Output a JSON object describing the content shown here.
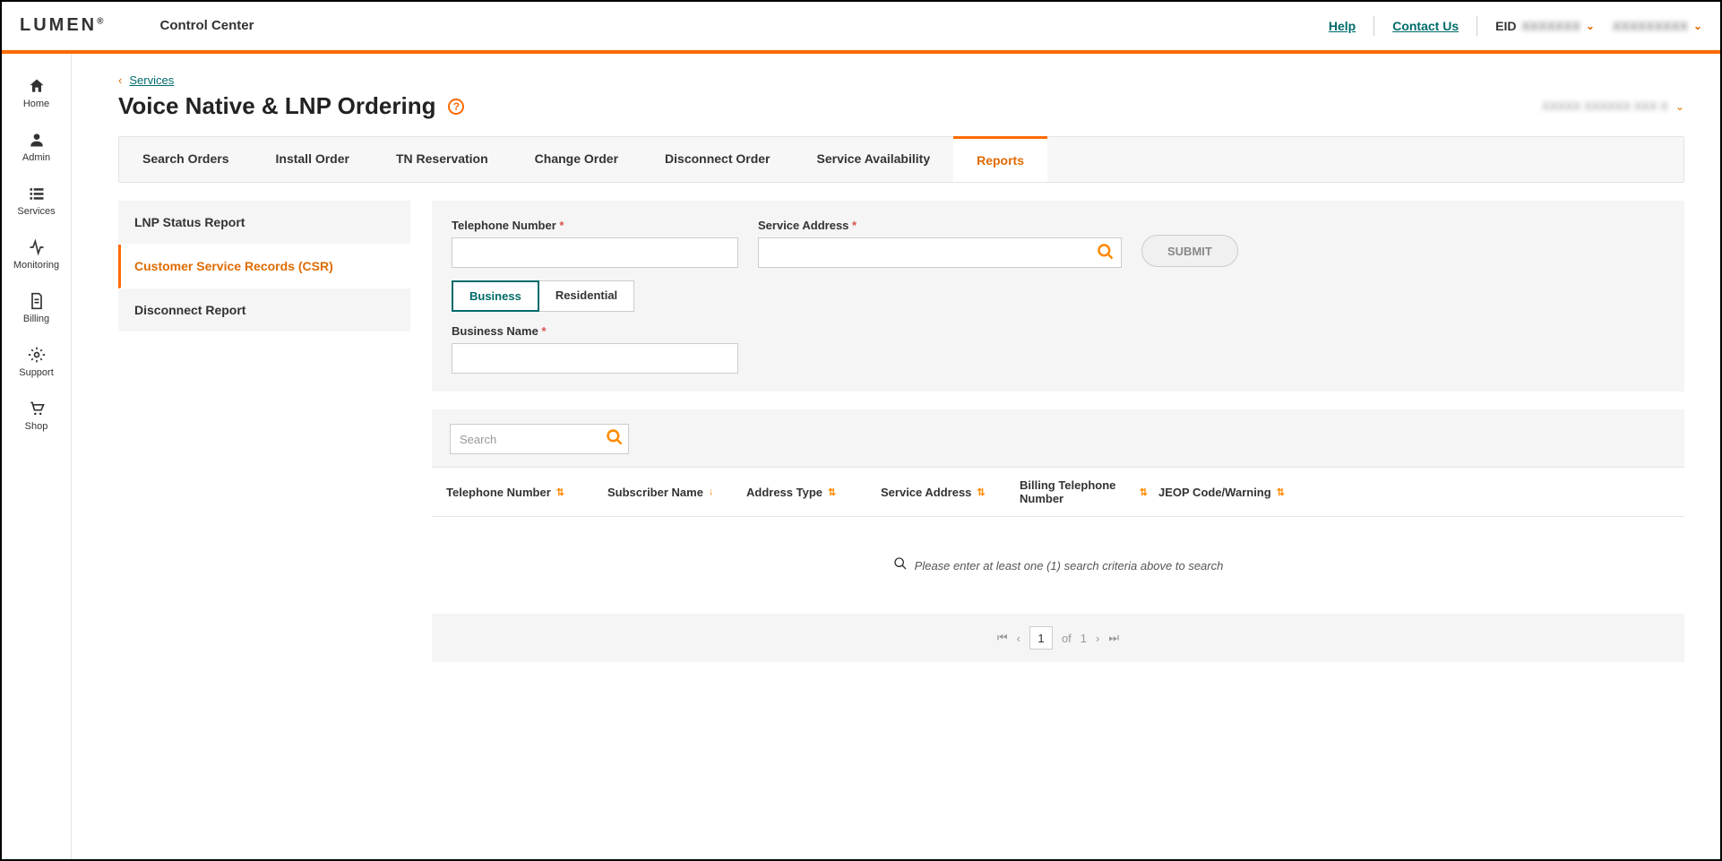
{
  "header": {
    "logo": "LUMEN",
    "app_title": "Control Center",
    "help": "Help",
    "contact": "Contact Us",
    "eid_label": "EID",
    "eid_value": "XXXXXXX",
    "account_label": "XXXXXXXXX"
  },
  "sidebar": {
    "items": [
      {
        "label": "Home"
      },
      {
        "label": "Admin"
      },
      {
        "label": "Services"
      },
      {
        "label": "Monitoring"
      },
      {
        "label": "Billing"
      },
      {
        "label": "Support"
      },
      {
        "label": "Shop"
      }
    ]
  },
  "breadcrumb": {
    "link": "Services"
  },
  "page": {
    "title": "Voice Native & LNP Ordering",
    "account_selector": "XXXXX XXXXXX XXX X"
  },
  "tabs": {
    "items": [
      {
        "label": "Search Orders"
      },
      {
        "label": "Install Order"
      },
      {
        "label": "TN Reservation"
      },
      {
        "label": "Change Order"
      },
      {
        "label": "Disconnect Order"
      },
      {
        "label": "Service Availability"
      },
      {
        "label": "Reports",
        "active": true
      }
    ]
  },
  "subnav": {
    "items": [
      {
        "label": "LNP Status Report"
      },
      {
        "label": "Customer Service Records (CSR)",
        "active": true
      },
      {
        "label": "Disconnect Report"
      }
    ]
  },
  "form": {
    "tn_label": "Telephone Number",
    "addr_label": "Service Address",
    "submit": "SUBMIT",
    "toggle": {
      "business": "Business",
      "residential": "Residential"
    },
    "bn_label": "Business Name"
  },
  "table": {
    "search_placeholder": "Search",
    "columns": [
      "Telephone Number",
      "Subscriber Name",
      "Address Type",
      "Service Address",
      "Billing Telephone Number",
      "JEOP Code/Warning"
    ],
    "empty_message": "Please enter at least one (1) search criteria above to search"
  },
  "pager": {
    "page": "1",
    "of": "of",
    "total": "1"
  }
}
